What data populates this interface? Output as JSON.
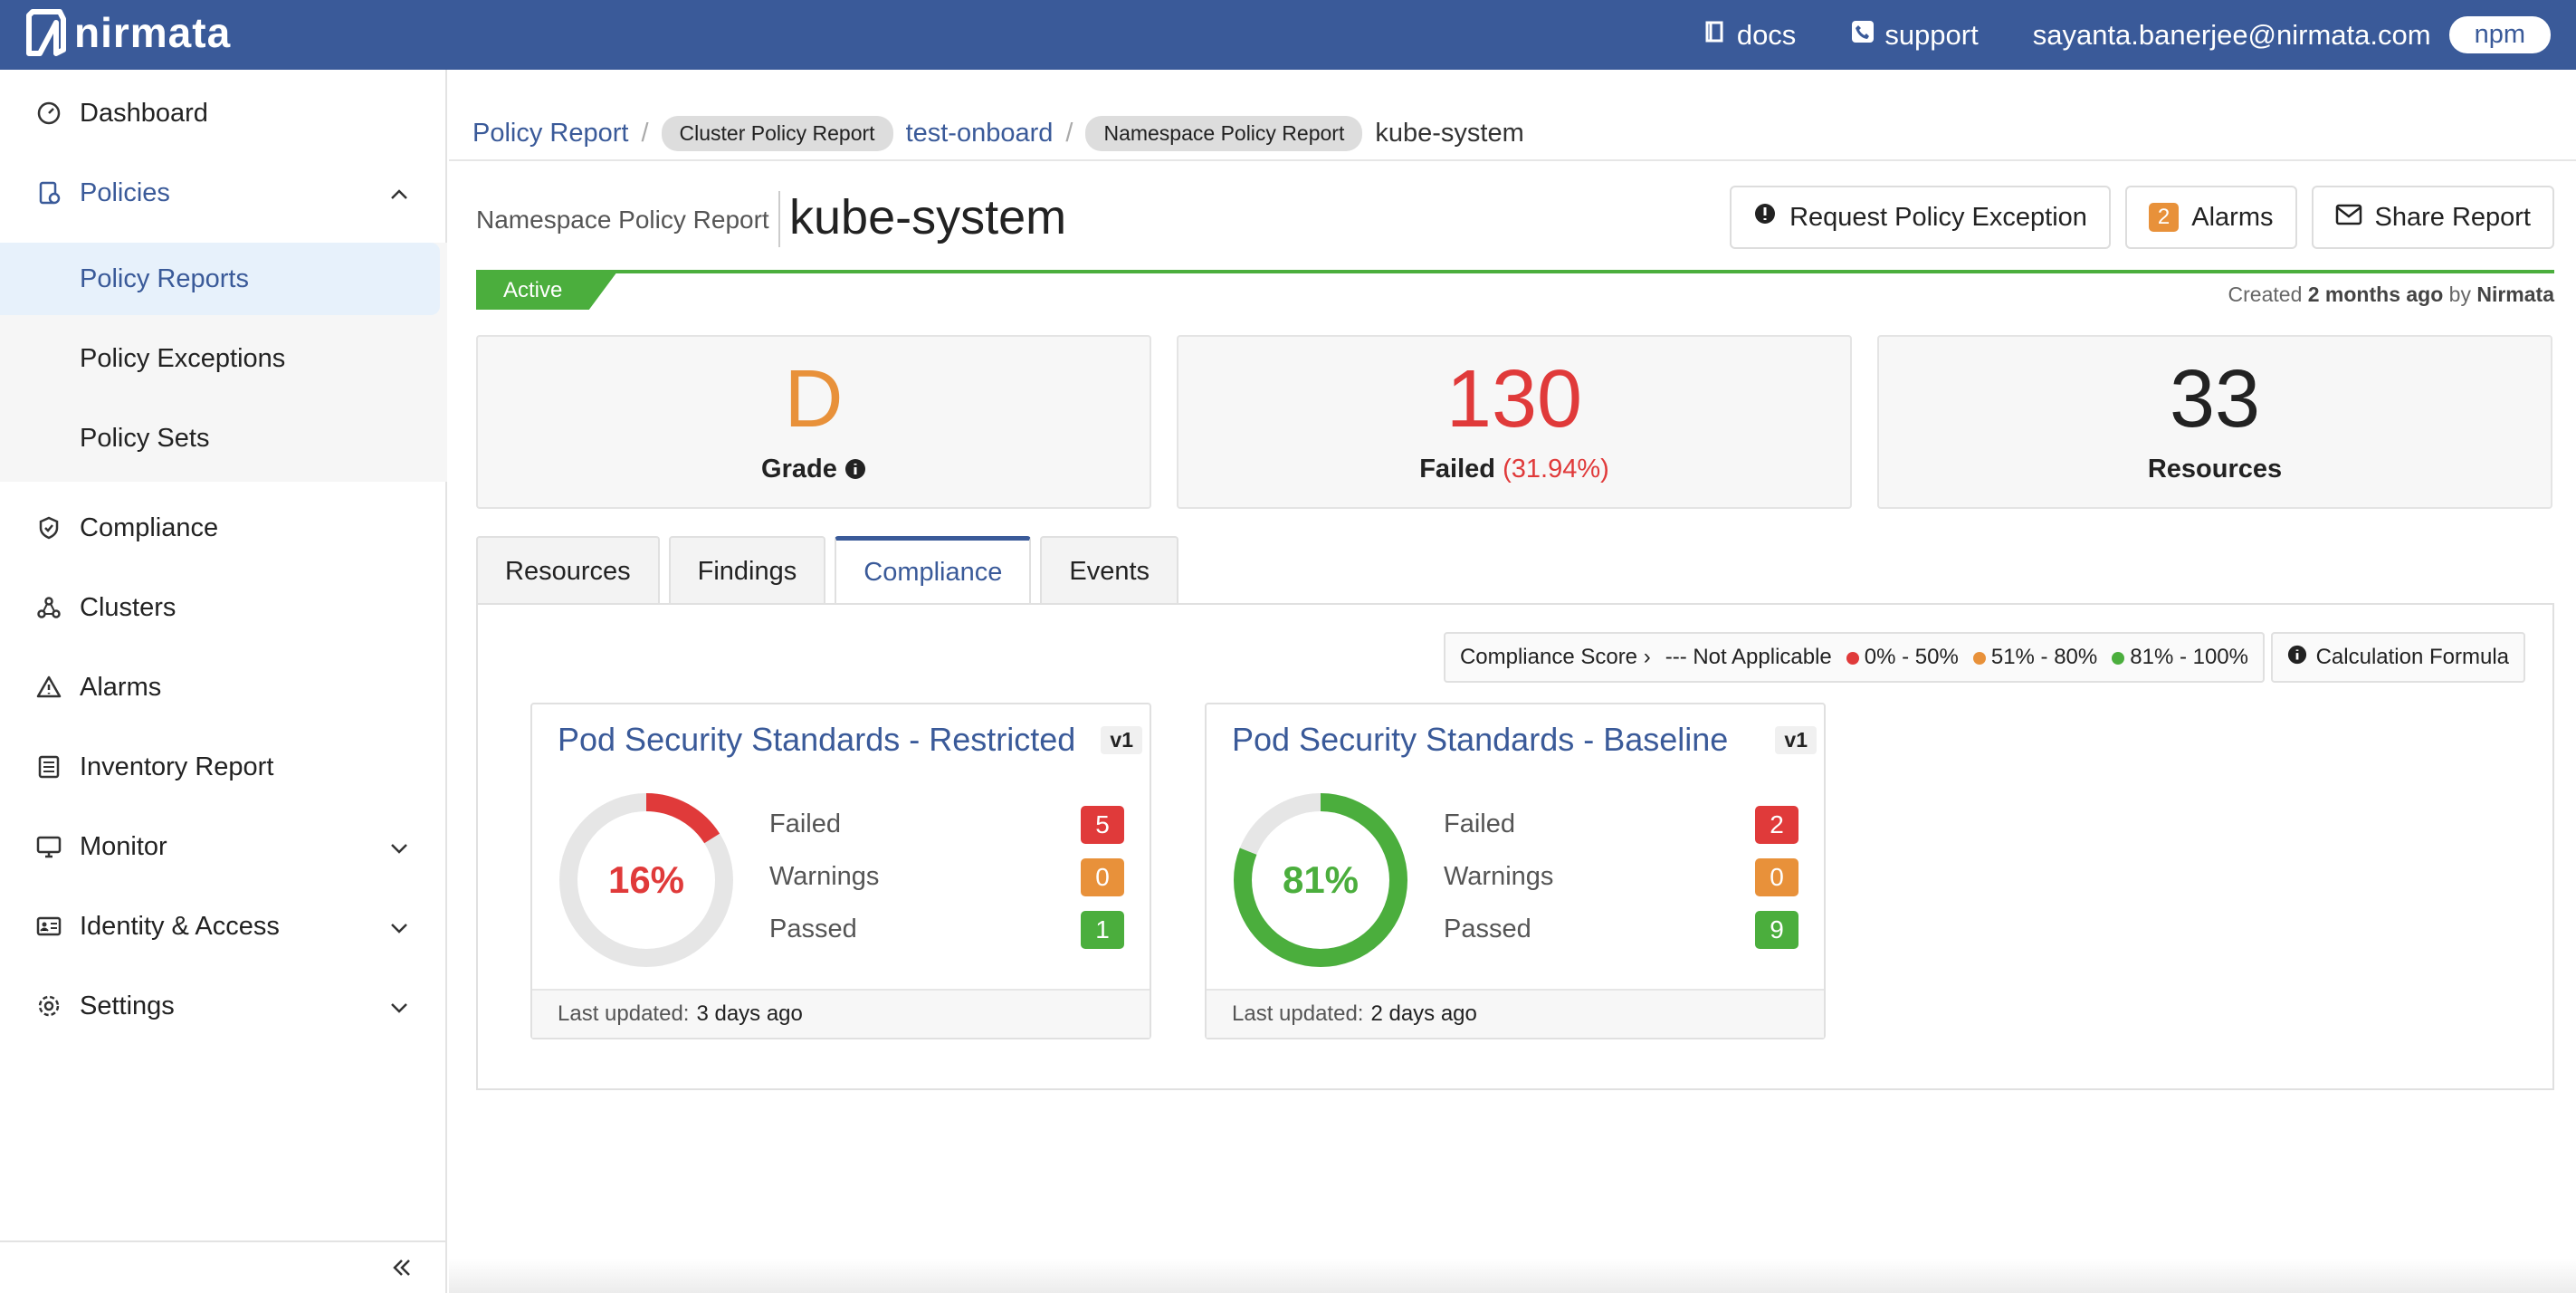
{
  "app": {
    "brand": "nirmata"
  },
  "topbar": {
    "docs_label": "docs",
    "support_label": "support",
    "user_email": "sayanta.banerjee@nirmata.com",
    "tenant": "npm"
  },
  "sidebar": {
    "items": [
      {
        "label": "Dashboard",
        "icon": "gauge-icon"
      },
      {
        "label": "Policies",
        "icon": "policy-doc-icon"
      },
      {
        "label": "Compliance",
        "icon": "shield-check-icon"
      },
      {
        "label": "Clusters",
        "icon": "cluster-nodes-icon"
      },
      {
        "label": "Alarms",
        "icon": "warning-triangle-icon"
      },
      {
        "label": "Inventory Report",
        "icon": "list-doc-icon"
      },
      {
        "label": "Monitor",
        "icon": "monitor-icon"
      },
      {
        "label": "Identity & Access",
        "icon": "id-card-icon"
      },
      {
        "label": "Settings",
        "icon": "gear-icon"
      }
    ],
    "policies_subitems": [
      "Policy Reports",
      "Policy Exceptions",
      "Policy Sets"
    ]
  },
  "breadcrumb": {
    "root": "Policy Report",
    "cluster_badge": "Cluster Policy Report",
    "cluster": "test-onboard",
    "namespace_badge": "Namespace Policy Report",
    "namespace": "kube-system"
  },
  "header": {
    "type_label": "Namespace Policy Report",
    "name": "kube-system",
    "request_exception_label": "Request Policy Exception",
    "alarms_count": "2",
    "alarms_label": "Alarms",
    "share_label": "Share Report"
  },
  "status": {
    "state": "Active",
    "created_prefix": "Created",
    "created_when": "2 months ago",
    "created_by_prefix": "by",
    "created_by": "Nirmata"
  },
  "stats": {
    "grade": {
      "value": "D",
      "label": "Grade"
    },
    "failed": {
      "value": "130",
      "label": "Failed",
      "percent": "(31.94%)"
    },
    "resources": {
      "value": "33",
      "label": "Resources"
    }
  },
  "tabs": [
    "Resources",
    "Findings",
    "Compliance",
    "Events"
  ],
  "active_tab": "Compliance",
  "legend": {
    "score_label": "Compliance Score",
    "not_applicable": "--- Not Applicable",
    "range_low": "0% - 50%",
    "range_mid": "51% - 80%",
    "range_high": "81% - 100%",
    "calc_label": "Calculation Formula"
  },
  "colors": {
    "brand": "#3a5a99",
    "fail": "#e03a3a",
    "warn": "#e8913a",
    "pass": "#4bae3d"
  },
  "compliance_cards": [
    {
      "title": "Pod Security Standards - Restricted",
      "version": "v1",
      "score": "16%",
      "score_fraction": 0.16,
      "failed_label": "Failed",
      "failed": "5",
      "warnings_label": "Warnings",
      "warnings": "0",
      "passed_label": "Passed",
      "passed": "1",
      "updated_label": "Last updated:",
      "updated": "3 days ago"
    },
    {
      "title": "Pod Security Standards - Baseline",
      "version": "v1",
      "score": "81%",
      "score_fraction": 0.81,
      "failed_label": "Failed",
      "failed": "2",
      "warnings_label": "Warnings",
      "warnings": "0",
      "passed_label": "Passed",
      "passed": "9",
      "updated_label": "Last updated:",
      "updated": "2 days ago"
    }
  ]
}
